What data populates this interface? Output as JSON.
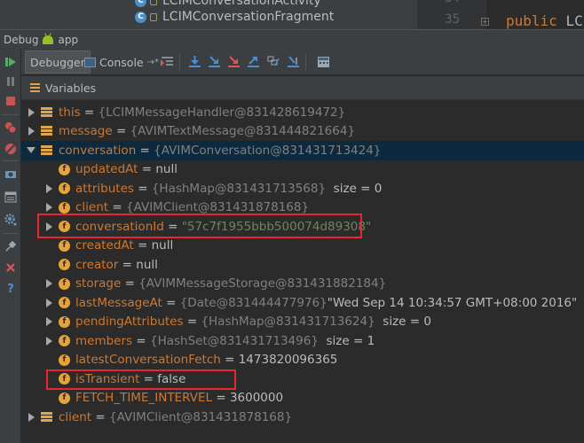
{
  "editor": {
    "tree_file_1": "LCIMConversationActivity",
    "tree_file_2": "LCIMConversationFragment",
    "line_numbers": [
      "34",
      "35"
    ],
    "code_keyword": "public",
    "code_ident": "LCI"
  },
  "debug_window": {
    "title": "Debug",
    "config": "app"
  },
  "tabs": {
    "debugger": "Debugger",
    "console": "Console",
    "console_suffix": "→*"
  },
  "panel": {
    "title": "Variables"
  },
  "variables": [
    {
      "name": "this",
      "eq": " = ",
      "value": "{LCIMMessageHandler@831428619472}",
      "extra": ""
    },
    {
      "name": "message",
      "eq": " = ",
      "value": "{AVIMTextMessage@831444821664}",
      "extra": ""
    },
    {
      "name": "conversation",
      "eq": " = ",
      "value": "{AVIMConversation@831431713424}",
      "extra": ""
    },
    {
      "name": "updatedAt",
      "eq": " = ",
      "value": "null",
      "extra": ""
    },
    {
      "name": "attributes",
      "eq": " = ",
      "value": "{HashMap@831431713568}",
      "extra": "  size = 0"
    },
    {
      "name": "client",
      "eq": " = ",
      "value": "{AVIMClient@831431878168}",
      "extra": ""
    },
    {
      "name": "conversationId",
      "eq": " = ",
      "value": "\"57c7f1955bbb500074d89308\"",
      "extra": ""
    },
    {
      "name": "createdAt",
      "eq": " = ",
      "value": "null",
      "extra": ""
    },
    {
      "name": "creator",
      "eq": " = ",
      "value": "null",
      "extra": ""
    },
    {
      "name": "storage",
      "eq": " = ",
      "value": "{AVIMMessageStorage@831431882184}",
      "extra": ""
    },
    {
      "name": "lastMessageAt",
      "eq": " = ",
      "value": "{Date@831444477976}",
      "extra": " \"Wed Sep 14 10:34:57 GMT+08:00 2016\""
    },
    {
      "name": "pendingAttributes",
      "eq": " = ",
      "value": "{HashMap@831431713624}",
      "extra": "  size = 0"
    },
    {
      "name": "members",
      "eq": " = ",
      "value": "{HashSet@831431713496}",
      "extra": "  size = 1"
    },
    {
      "name": "latestConversationFetch",
      "eq": " = ",
      "value": "1473820096365",
      "extra": ""
    },
    {
      "name": "isTransient",
      "eq": " = ",
      "value": "false",
      "extra": ""
    },
    {
      "name": "FETCH_TIME_INTERVEL",
      "eq": " = ",
      "value": "3600000",
      "extra": ""
    },
    {
      "name": "client",
      "eq": " = ",
      "value": "{AVIMClient@831431878168}",
      "extra": ""
    }
  ],
  "colors": {
    "name": "#cc7832",
    "reference": "#808080",
    "string": "#6a8759",
    "highlight_border": "#e8262e",
    "field_icon": "#e6a23c"
  }
}
